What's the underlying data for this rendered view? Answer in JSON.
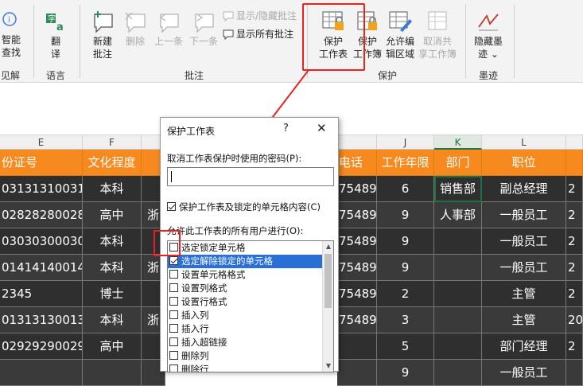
{
  "ribbon": {
    "groups": {
      "insight": "见解",
      "language": "语言",
      "comments": "批注",
      "protect": "保护",
      "ink": "墨迹"
    },
    "smart_lookup": [
      "智能",
      "查找"
    ],
    "translate": [
      "翻",
      "译"
    ],
    "new_comment": [
      "新建",
      "批注"
    ],
    "delete": "删除",
    "prev": "上一条",
    "next": "下一条",
    "show_hide_comment": "显示/隐藏批注",
    "show_all_comments": "显示所有批注",
    "protect_sheet": [
      "保护",
      "工作表"
    ],
    "protect_workbook": [
      "保护",
      "工作簿"
    ],
    "allow_edit_ranges": [
      "允许编",
      "辑区域"
    ],
    "unshare_workbook": [
      "取消共",
      "享工作簿"
    ],
    "hide_ink": [
      "隐藏墨",
      "迹"
    ],
    "hide_ink_arrow": "⌄"
  },
  "columns": [
    "E",
    "F",
    "J",
    "K",
    "L"
  ],
  "headers": {
    "e": "份证号",
    "f": "文化程度",
    "phone": "电话",
    "j": "工作年限",
    "k": "部门",
    "l": "职位"
  },
  "rows": [
    {
      "e": "03131310031",
      "f": "本科",
      "g": "",
      "phone": "75489",
      "j": "6",
      "k": "销售部",
      "l": "副总经理",
      "m": "2"
    },
    {
      "e": "02828280028",
      "f": "高中",
      "g": "浙",
      "phone": "75489",
      "j": "9",
      "k": "人事部",
      "l": "一般员工",
      "m": "2"
    },
    {
      "e": "03030300030",
      "f": "本科",
      "g": "",
      "phone": "75489",
      "j": "9",
      "k": "",
      "l": "一般员工",
      "m": "2"
    },
    {
      "e": "01414140014",
      "f": "本科",
      "g": "浙",
      "phone": "75489",
      "j": "9",
      "k": "",
      "l": "一般员工",
      "m": "2"
    },
    {
      "e": "2345",
      "f": "博士",
      "g": "",
      "phone": "75489",
      "j": "2",
      "k": "",
      "l": "主管",
      "m": "2"
    },
    {
      "e": "01313130013",
      "f": "本科",
      "g": "浙",
      "phone": "75489",
      "j": "3",
      "k": "",
      "l": "主管",
      "m": "20"
    },
    {
      "e": "02929290029",
      "f": "高中",
      "g": "",
      "phone": "",
      "j": "5",
      "k": "",
      "l": "部门经理",
      "m": "2"
    },
    {
      "e": "",
      "f": "",
      "g": "",
      "phone": "",
      "j": "9",
      "k": "",
      "l": "一般员工",
      "m": ""
    }
  ],
  "dialog": {
    "title": "保护工作表",
    "help": "?",
    "close": "✕",
    "password_label": "取消工作表保护时使用的密码(P):",
    "protect_checkbox": "保护工作表及锁定的单元格内容(C)",
    "allow_label": "允许此工作表的所有用户进行(O):",
    "options": [
      {
        "label": "选定锁定单元格",
        "checked": false,
        "selected": false
      },
      {
        "label": "选定解除锁定的单元格",
        "checked": true,
        "selected": true
      },
      {
        "label": "设置单元格格式",
        "checked": false,
        "selected": false
      },
      {
        "label": "设置列格式",
        "checked": false,
        "selected": false
      },
      {
        "label": "设置行格式",
        "checked": false,
        "selected": false
      },
      {
        "label": "插入列",
        "checked": false,
        "selected": false
      },
      {
        "label": "插入行",
        "checked": false,
        "selected": false
      },
      {
        "label": "插入超链接",
        "checked": false,
        "selected": false
      },
      {
        "label": "删除列",
        "checked": false,
        "selected": false
      },
      {
        "label": "删除行",
        "checked": false,
        "selected": false
      }
    ]
  },
  "colors": {
    "accent_red": "#e8231f",
    "header_orange": "#f68a1e",
    "selection_blue": "#2a6fd6",
    "excel_green": "#217346"
  }
}
